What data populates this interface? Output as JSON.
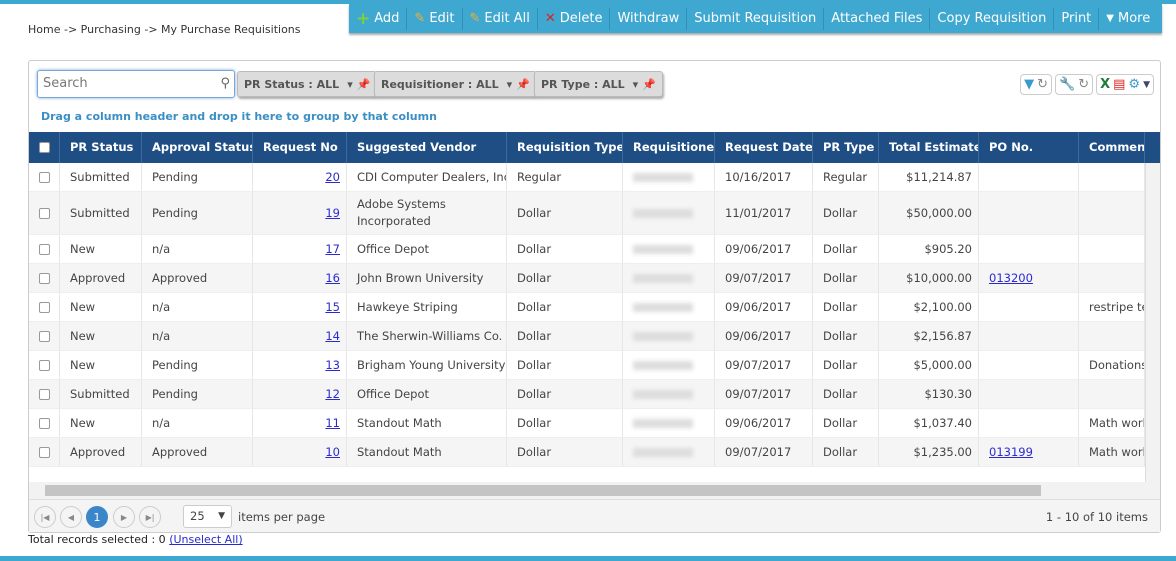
{
  "breadcrumb": "Home -> Purchasing -> My Purchase Requisitions",
  "toolbar": [
    {
      "label": "Add",
      "icon": "plus-icon"
    },
    {
      "label": "Edit",
      "icon": "pencil-icon"
    },
    {
      "label": "Edit All",
      "icon": "pencil-icon"
    },
    {
      "label": "Delete",
      "icon": "x-icon"
    },
    {
      "label": "Withdraw"
    },
    {
      "label": "Submit Requisition"
    },
    {
      "label": "Attached Files"
    },
    {
      "label": "Copy Requisition"
    },
    {
      "label": "Print"
    },
    {
      "label": "More",
      "icon": "caret-down-icon"
    }
  ],
  "search": {
    "placeholder": "Search"
  },
  "filters": [
    "PR Status : ALL",
    "Requisitioner : ALL",
    "PR Type : ALL"
  ],
  "group_hint": "Drag a column header and drop it here to group by that column",
  "columns": [
    "PR Status",
    "Approval Status",
    "Request No",
    "Suggested Vendor",
    "Requisition Type",
    "Requisitioner",
    "Request Date",
    "PR Type",
    "Total Estimate",
    "PO No.",
    "Comments"
  ],
  "rows": [
    [
      "Submitted",
      "Pending",
      "20",
      "CDI Computer Dealers, Inc.",
      "Regular",
      "",
      "10/16/2017",
      "Regular",
      "$11,214.87",
      "",
      ""
    ],
    [
      "Submitted",
      "Pending",
      "19",
      "Adobe Systems Incorporated",
      "Dollar",
      "",
      "11/01/2017",
      "Dollar",
      "$50,000.00",
      "",
      ""
    ],
    [
      "New",
      "n/a",
      "17",
      "Office Depot",
      "Dollar",
      "",
      "09/06/2017",
      "Dollar",
      "$905.20",
      "",
      ""
    ],
    [
      "Approved",
      "Approved",
      "16",
      "John Brown University",
      "Dollar",
      "",
      "09/07/2017",
      "Dollar",
      "$10,000.00",
      "013200",
      ""
    ],
    [
      "New",
      "n/a",
      "15",
      "Hawkeye Striping",
      "Dollar",
      "",
      "09/06/2017",
      "Dollar",
      "$2,100.00",
      "",
      "restripe tea"
    ],
    [
      "New",
      "n/a",
      "14",
      "The Sherwin-Williams Co.",
      "Dollar",
      "",
      "09/06/2017",
      "Dollar",
      "$2,156.87",
      "",
      ""
    ],
    [
      "New",
      "Pending",
      "13",
      "Brigham Young University",
      "Dollar",
      "",
      "09/07/2017",
      "Dollar",
      "$5,000.00",
      "",
      "Donations"
    ],
    [
      "Submitted",
      "Pending",
      "12",
      "Office Depot",
      "Dollar",
      "",
      "09/07/2017",
      "Dollar",
      "$130.30",
      "",
      ""
    ],
    [
      "New",
      "n/a",
      "11",
      "Standout Math",
      "Dollar",
      "",
      "09/06/2017",
      "Dollar",
      "$1,037.40",
      "",
      "Math work"
    ],
    [
      "Approved",
      "Approved",
      "10",
      "Standout Math",
      "Dollar",
      "",
      "09/07/2017",
      "Dollar",
      "$1,235.00",
      "013199",
      "Math work"
    ]
  ],
  "pager": {
    "page": "1",
    "page_size": "25",
    "items_per_page": "items per page",
    "summary": "1 - 10 of 10 items"
  },
  "footer": {
    "total": "Total records selected : 0",
    "unselect": "(Unselect All)"
  }
}
